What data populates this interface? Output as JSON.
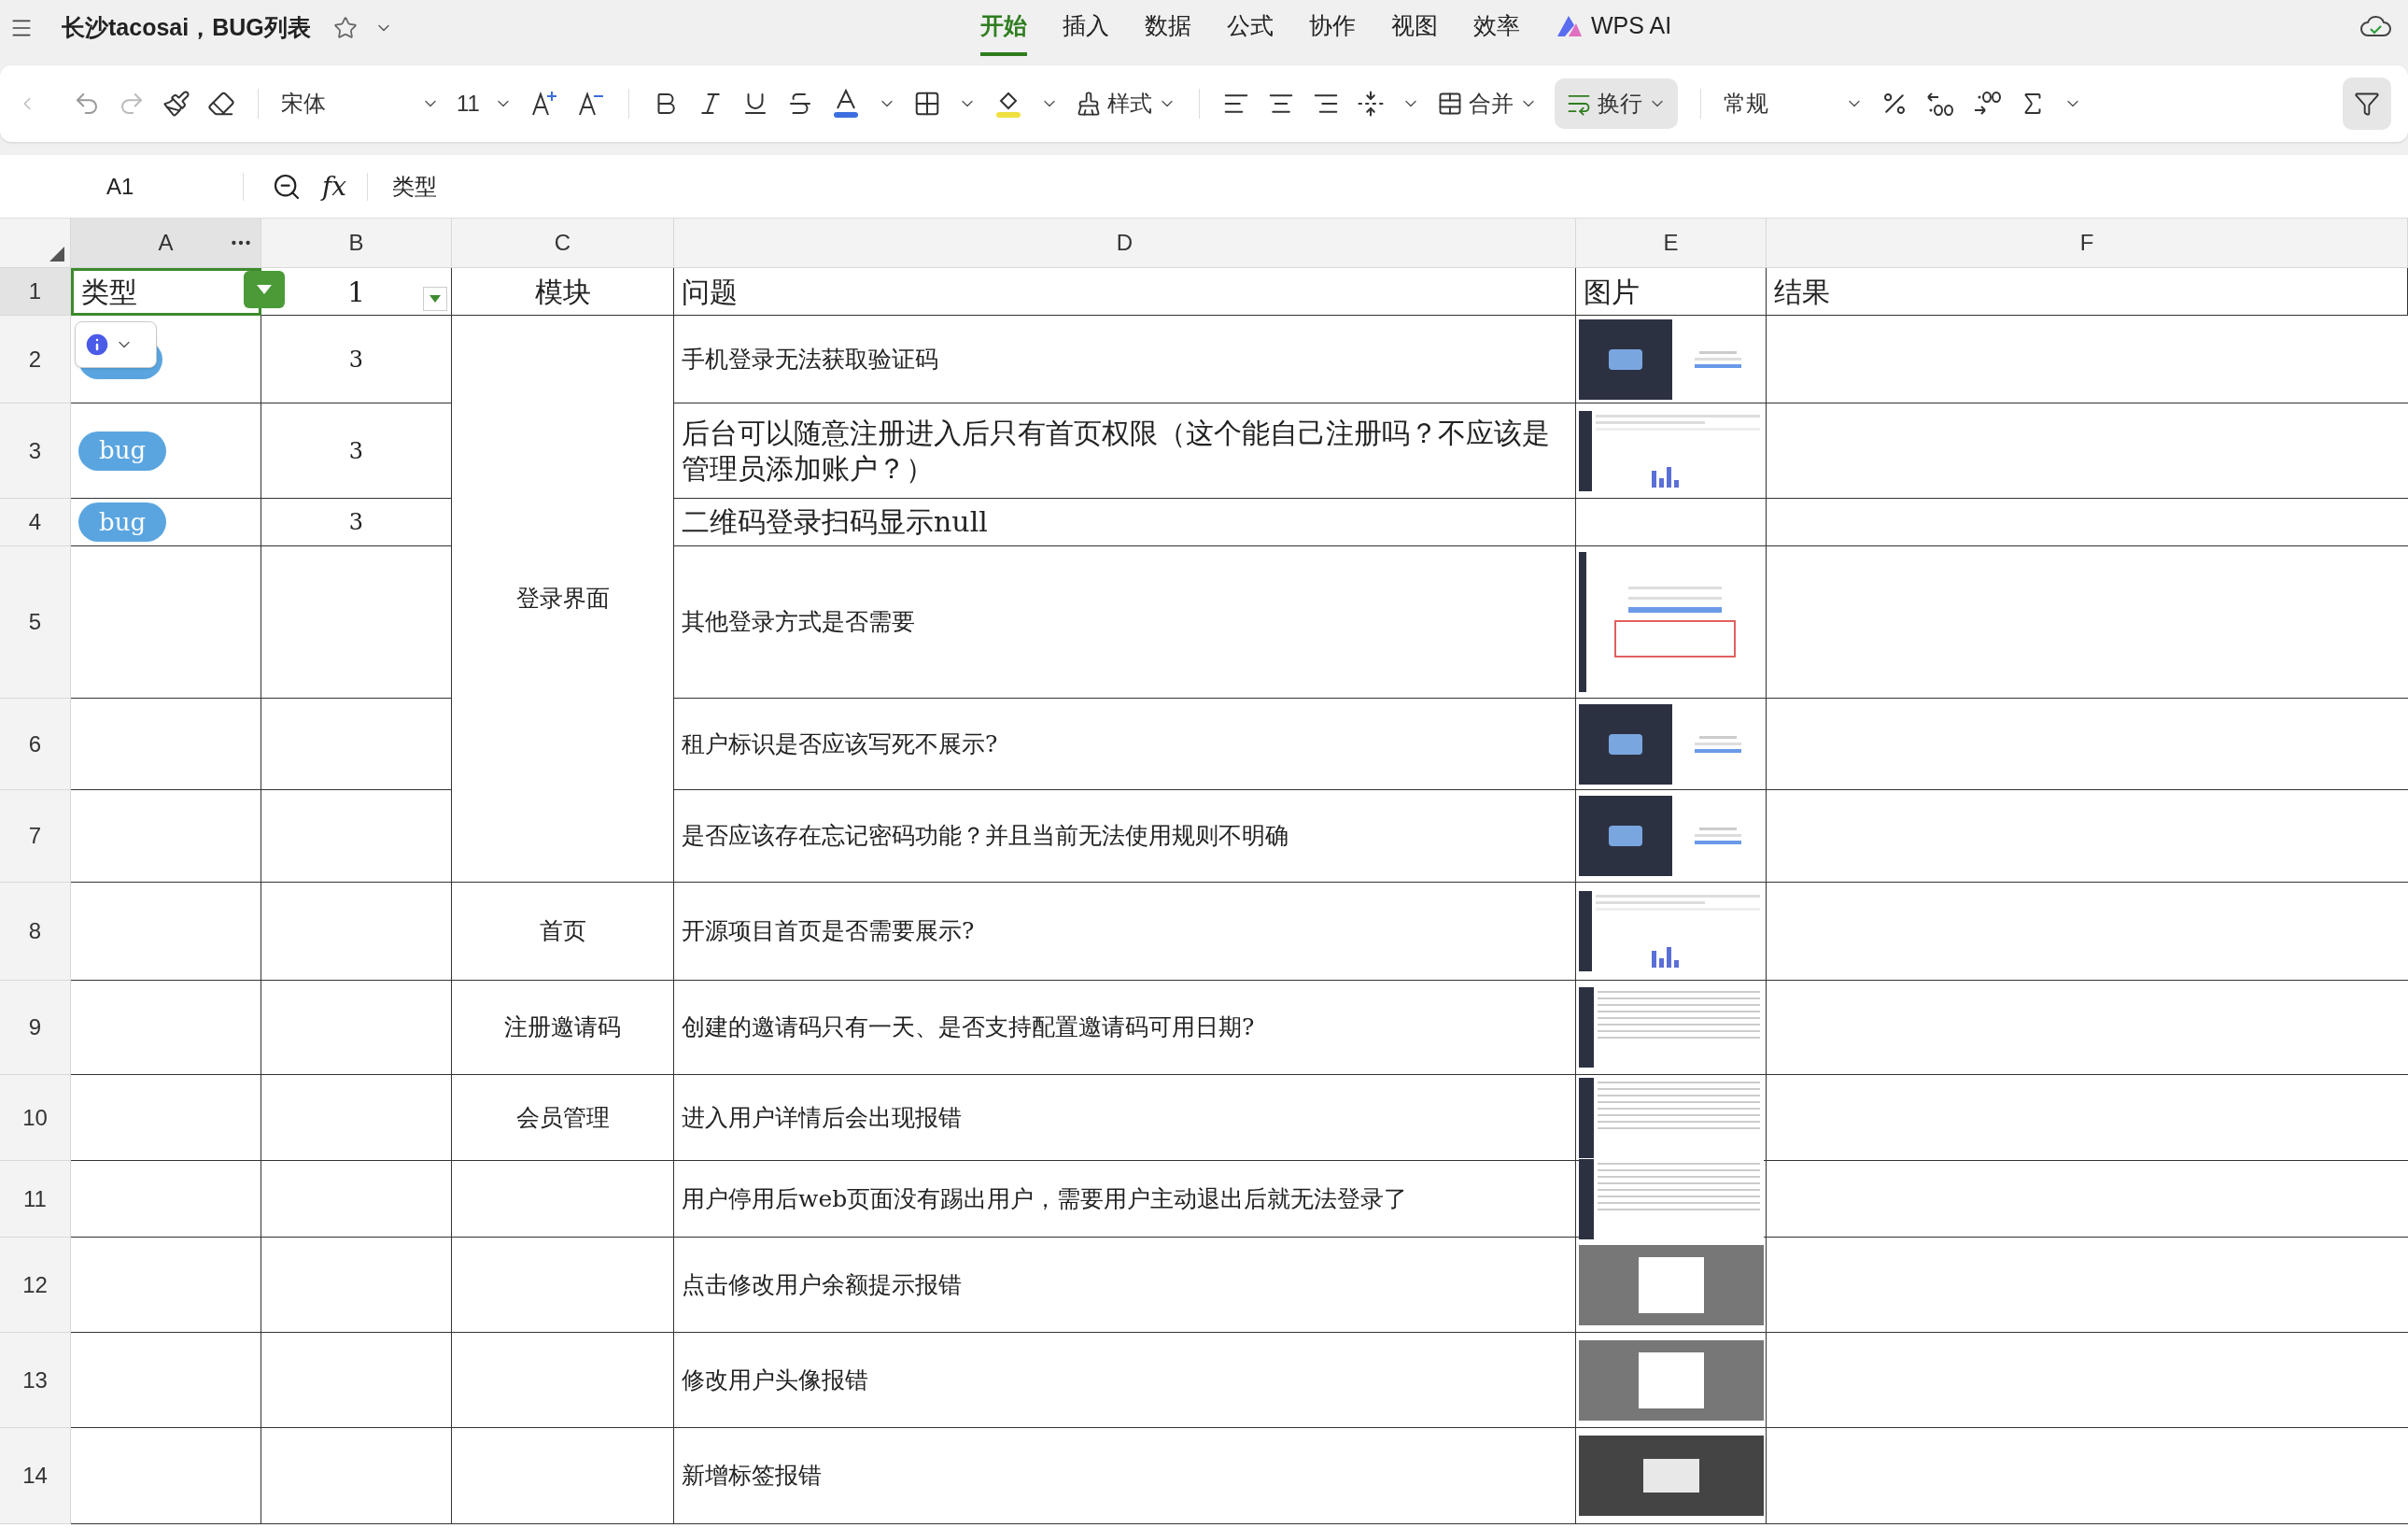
{
  "title_bar": {
    "title": "长沙tacosai，BUG列表",
    "starred": false
  },
  "menu_tabs": [
    {
      "label": "开始",
      "selected": true
    },
    {
      "label": "插入",
      "selected": false
    },
    {
      "label": "数据",
      "selected": false
    },
    {
      "label": "公式",
      "selected": false
    },
    {
      "label": "协作",
      "selected": false
    },
    {
      "label": "视图",
      "selected": false
    },
    {
      "label": "效率",
      "selected": false
    },
    {
      "label": "WPS AI",
      "selected": false,
      "kind": "ai"
    }
  ],
  "toolbar": {
    "font": "宋体",
    "font_size": "11",
    "style_label": "样式",
    "merge_label": "合并",
    "wrap_label": "换行",
    "wrap_active": true,
    "number_format": "常规",
    "filter_active": true
  },
  "formula_bar": {
    "cell_ref": "A1",
    "fx_label": "fx",
    "value": "类型"
  },
  "columns": [
    {
      "letter": "A",
      "selected": true
    },
    {
      "letter": "B",
      "selected": false
    },
    {
      "letter": "C",
      "selected": false
    },
    {
      "letter": "D",
      "selected": false
    },
    {
      "letter": "E",
      "selected": false
    },
    {
      "letter": "F",
      "selected": false
    }
  ],
  "header_row": {
    "number": "1",
    "selected": true,
    "cells": [
      {
        "text": "类型",
        "selected": true,
        "filter": {
          "kind": "applied"
        }
      },
      {
        "text": "1",
        "selected": false,
        "filter": {
          "kind": "available"
        }
      },
      {
        "text": "模块",
        "selected": false
      },
      {
        "text": "问题",
        "selected": false
      },
      {
        "text": "图片",
        "selected": false
      },
      {
        "text": "结果",
        "selected": false
      }
    ]
  },
  "groups": [
    {
      "module": "登录界面",
      "rows": [
        {
          "number": "2",
          "tag_covered": true,
          "count": "3",
          "issue": {
            "text": "手机登录无法获取验证码",
            "kind": "normal"
          },
          "image": {
            "kind": "login"
          }
        },
        {
          "number": "3",
          "tag": "bug",
          "count": "3",
          "issue": {
            "text": "后台可以随意注册进入后只有首页权限（这个能自己注册吗？不应该是管理员添加账户？）",
            "kind": "large"
          },
          "image": {
            "kind": "dashboard"
          }
        },
        {
          "number": "4",
          "tag": "bug",
          "count": "3",
          "issue": {
            "text": "二维码登录扫码显示null",
            "kind": "large"
          }
        },
        {
          "number": "5",
          "issue": {
            "text": "其他登录方式是否需要",
            "kind": "normal"
          },
          "image": {
            "kind": "form"
          }
        },
        {
          "number": "6",
          "issue": {
            "text": "租户标识是否应该写死不展示?",
            "kind": "normal"
          },
          "image": {
            "kind": "login"
          }
        },
        {
          "number": "7",
          "issue": {
            "text": "是否应该存在忘记密码功能？并且当前无法使用规则不明确",
            "kind": "normal"
          },
          "image": {
            "kind": "login"
          }
        }
      ]
    },
    {
      "module": "首页",
      "rows": [
        {
          "number": "8",
          "issue": {
            "text": "开源项目首页是否需要展示?",
            "kind": "normal"
          },
          "image": {
            "kind": "dashboard"
          }
        }
      ]
    },
    {
      "module": "注册邀请码",
      "rows": [
        {
          "number": "9",
          "issue": {
            "text": "创建的邀请码只有一天、是否支持配置邀请码可用日期?",
            "kind": "normal"
          },
          "image": {
            "kind": "table"
          }
        }
      ]
    },
    {
      "module": "会员管理",
      "rows": [
        {
          "number": "10",
          "issue": {
            "text": "进入用户详情后会出现报错",
            "kind": "normal"
          },
          "image": {
            "kind": "table"
          }
        }
      ]
    },
    {
      "rows": [
        {
          "number": "11",
          "issue": {
            "text": "用户停用后web页面没有踢出用户，需要用户主动退出后就无法登录了",
            "kind": "normal"
          },
          "image": {
            "kind": "table"
          }
        }
      ]
    },
    {
      "rows": [
        {
          "number": "12",
          "issue": {
            "text": "点击修改用户余额提示报错",
            "kind": "normal"
          },
          "image": {
            "kind": "dialog"
          }
        }
      ]
    },
    {
      "rows": [
        {
          "number": "13",
          "issue": {
            "text": "修改用户头像报错",
            "kind": "normal"
          },
          "image": {
            "kind": "dialog"
          }
        }
      ]
    },
    {
      "rows": [
        {
          "number": "14",
          "issue": {
            "text": "新增标签报错",
            "kind": "normal"
          },
          "image": {
            "kind": "dark_dialog"
          }
        }
      ]
    }
  ]
}
